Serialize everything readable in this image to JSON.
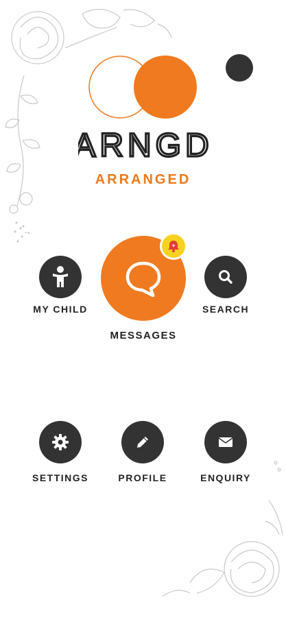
{
  "brand": {
    "logo_text": "ARNGD",
    "name": "ARRANGED"
  },
  "badge": {
    "count": "+"
  },
  "menu_top": {
    "my_child": "MY CHILD",
    "messages": "MESSAGES",
    "search": "SEARCH"
  },
  "menu_bottom": {
    "settings": "SETTINGS",
    "profile": "PROFILE",
    "enquiry": "ENQUIRY"
  },
  "colors": {
    "accent": "#f07a1f",
    "dark": "#333333",
    "badge": "#f7d21f"
  }
}
